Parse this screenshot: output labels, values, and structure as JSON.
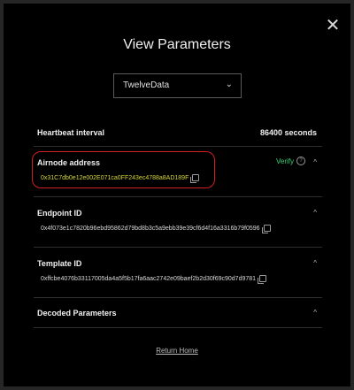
{
  "modal": {
    "title": "View Parameters",
    "close_glyph": "✕",
    "provider_select": {
      "value": "TwelveData",
      "chevron": "⌄"
    },
    "heartbeat": {
      "label": "Heartbeat interval",
      "value": "86400 seconds"
    },
    "airnode": {
      "label": "Airnode address",
      "verify_label": "Verify",
      "help_glyph": "?",
      "address": "0x31C7db0e12e002E071ca0FF243ec4788a8AD189F"
    },
    "endpoint": {
      "label": "Endpoint ID",
      "value": "0x4f073e1c7820b96ebd95862d79bd8b3c5a9ebb39e39cf6d4f16a3316b79f0596"
    },
    "template": {
      "label": "Template ID",
      "value": "0xffcbe4076b33117005da4a5f5b17fa6aac2742e09baef2b2d30f69c90d7d9781"
    },
    "decoded": {
      "label": "Decoded Parameters"
    },
    "caret_glyph": "^",
    "return_link": "Return Home"
  },
  "colors": {
    "background": "#262626",
    "modal": "#000000",
    "accent_green": "#3fd27a",
    "highlight_red": "#d21f1f",
    "address_yellow": "#d6d63a"
  }
}
